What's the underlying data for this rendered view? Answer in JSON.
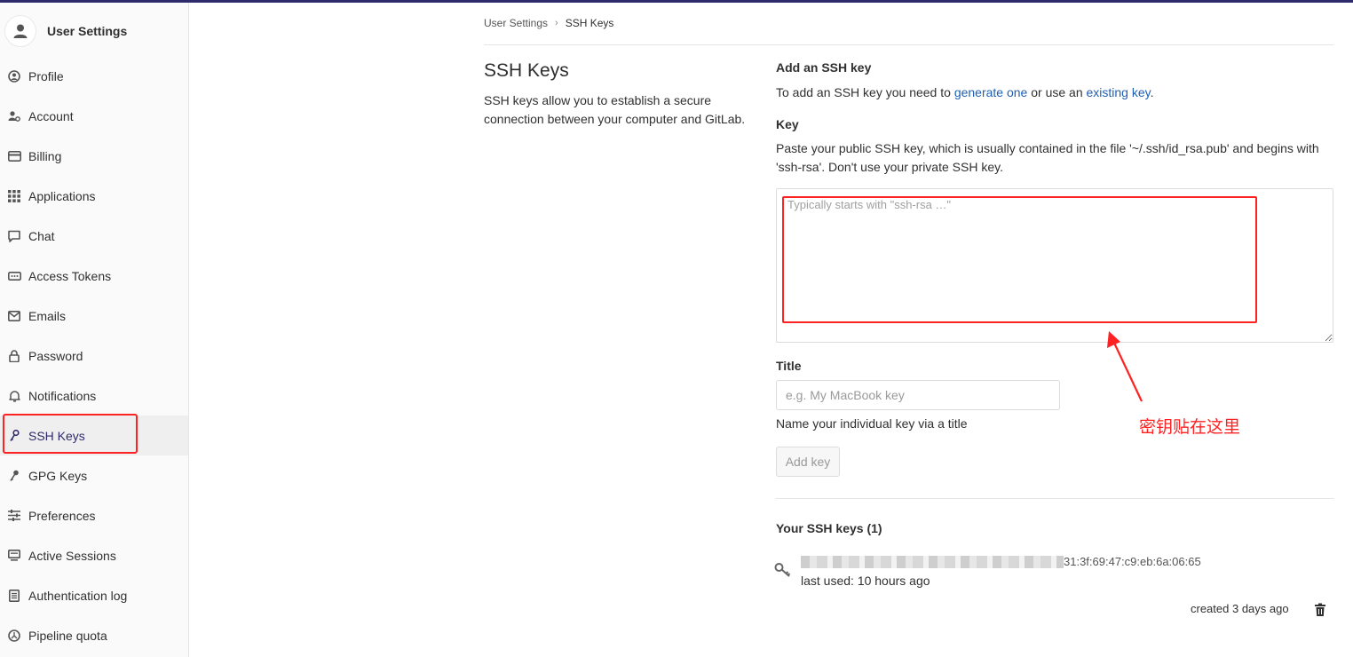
{
  "sidebar": {
    "title": "User Settings",
    "items": [
      {
        "label": "Profile",
        "icon": "profile-icon"
      },
      {
        "label": "Account",
        "icon": "account-icon"
      },
      {
        "label": "Billing",
        "icon": "billing-icon"
      },
      {
        "label": "Applications",
        "icon": "applications-icon"
      },
      {
        "label": "Chat",
        "icon": "chat-icon"
      },
      {
        "label": "Access Tokens",
        "icon": "token-icon"
      },
      {
        "label": "Emails",
        "icon": "email-icon"
      },
      {
        "label": "Password",
        "icon": "lock-icon"
      },
      {
        "label": "Notifications",
        "icon": "bell-icon"
      },
      {
        "label": "SSH Keys",
        "icon": "key-icon"
      },
      {
        "label": "GPG Keys",
        "icon": "key-icon"
      },
      {
        "label": "Preferences",
        "icon": "sliders-icon"
      },
      {
        "label": "Active Sessions",
        "icon": "monitor-icon"
      },
      {
        "label": "Authentication log",
        "icon": "log-icon"
      },
      {
        "label": "Pipeline quota",
        "icon": "quota-icon"
      }
    ],
    "active": "SSH Keys"
  },
  "breadcrumb": {
    "parent": "User Settings",
    "current": "SSH Keys"
  },
  "page": {
    "title": "SSH Keys",
    "description": "SSH keys allow you to establish a secure connection between your computer and GitLab."
  },
  "form": {
    "heading": "Add an SSH key",
    "intro_prefix": "To add an SSH key you need to ",
    "intro_link1": "generate one",
    "intro_mid": " or use an ",
    "intro_link2": "existing key",
    "intro_suffix": ".",
    "key_label": "Key",
    "key_help": "Paste your public SSH key, which is usually contained in the file '~/.ssh/id_rsa.pub' and begins with 'ssh-rsa'. Don't use your private SSH key.",
    "key_placeholder": "Typically starts with \"ssh-rsa …\"",
    "title_label": "Title",
    "title_placeholder": "e.g. My MacBook key",
    "title_help": "Name your individual key via a title",
    "add_button": "Add key"
  },
  "keys": {
    "heading": "Your SSH keys (1)",
    "items": [
      {
        "fingerprint_tail": "31:3f:69:47:c9:eb:6a:06:65",
        "last_used": "last used: 10 hours ago",
        "created": "created 3 days ago"
      }
    ]
  },
  "annotation": {
    "text": "密钥贴在这里",
    "color": "#ff2222"
  },
  "colors": {
    "accent": "#2f2a6b",
    "link": "#1f5fb3",
    "annotation": "#ff2222"
  }
}
